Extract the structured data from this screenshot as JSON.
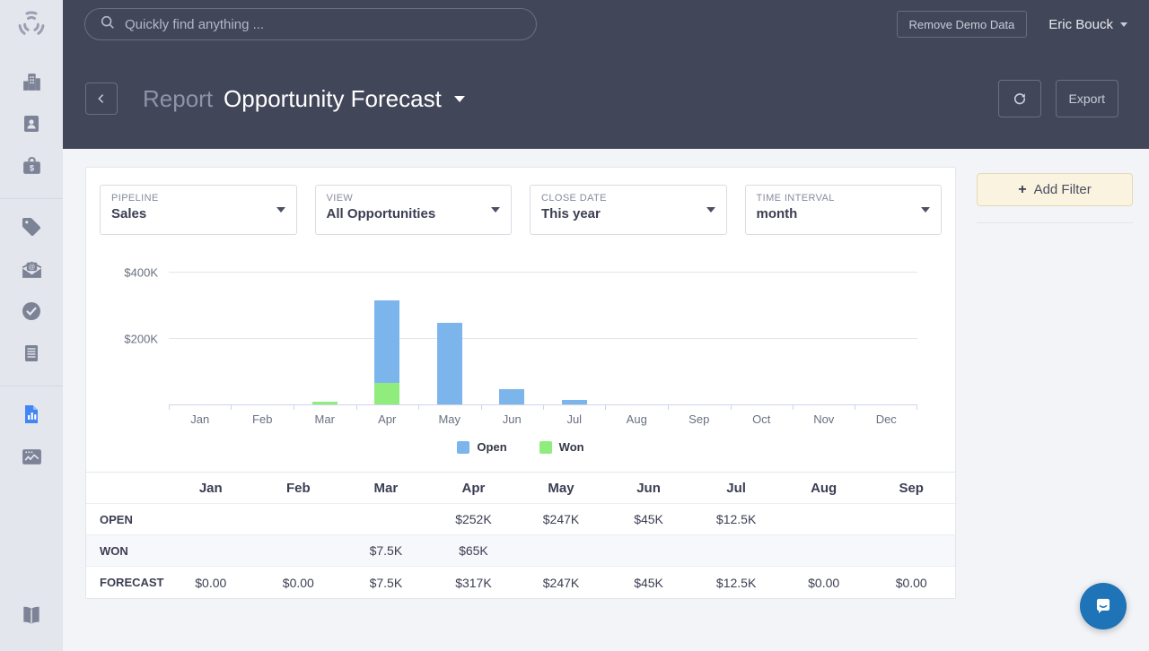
{
  "topbar": {
    "search_placeholder": "Quickly find anything ...",
    "remove_demo_label": "Remove Demo Data",
    "user_name": "Eric Bouck"
  },
  "report_header": {
    "kicker": "Report",
    "title": "Opportunity Forecast",
    "export_label": "Export"
  },
  "filters": [
    {
      "label": "PIPELINE",
      "value": "Sales"
    },
    {
      "label": "VIEW",
      "value": "All Opportunities"
    },
    {
      "label": "CLOSE DATE",
      "value": "This year"
    },
    {
      "label": "TIME INTERVAL",
      "value": "month"
    }
  ],
  "side_panel": {
    "add_filter_label": "Add Filter",
    "plus": "+"
  },
  "chart_data": {
    "type": "bar",
    "stacked": true,
    "categories": [
      "Jan",
      "Feb",
      "Mar",
      "Apr",
      "May",
      "Jun",
      "Jul",
      "Aug",
      "Sep",
      "Oct",
      "Nov",
      "Dec"
    ],
    "series": [
      {
        "name": "Won",
        "color": "#90ed7d",
        "values": [
          0,
          0,
          7500,
          65000,
          0,
          0,
          0,
          0,
          0,
          0,
          0,
          0
        ]
      },
      {
        "name": "Open",
        "color": "#7cb5ec",
        "values": [
          0,
          0,
          0,
          252000,
          247000,
          45000,
          12500,
          0,
          0,
          0,
          0,
          0
        ]
      }
    ],
    "legend": [
      {
        "name": "Open",
        "color": "#7cb5ec"
      },
      {
        "name": "Won",
        "color": "#90ed7d"
      }
    ],
    "yticks": [
      {
        "label": "$400K",
        "value": 400000
      },
      {
        "label": "$200K",
        "value": 200000
      }
    ],
    "ylim": [
      0,
      400000
    ],
    "grid": true,
    "legend_position": "bottom"
  },
  "table": {
    "columns": [
      "Jan",
      "Feb",
      "Mar",
      "Apr",
      "May",
      "Jun",
      "Jul",
      "Aug",
      "Sep"
    ],
    "rows": [
      {
        "label": "OPEN",
        "values": [
          "",
          "",
          "",
          "$252K",
          "$247K",
          "$45K",
          "$12.5K",
          "",
          ""
        ]
      },
      {
        "label": "WON",
        "values": [
          "",
          "",
          "$7.5K",
          "$65K",
          "",
          "",
          "",
          "",
          ""
        ]
      },
      {
        "label": "FORECAST",
        "values": [
          "$0.00",
          "$0.00",
          "$7.5K",
          "$317K",
          "$247K",
          "$45K",
          "$12.5K",
          "$0.00",
          "$0.00"
        ]
      }
    ]
  },
  "colors": {
    "open_bar": "#7cb5ec",
    "won_bar": "#90ed7d",
    "header_bg": "#424659",
    "rail_bg": "#e4e6ee",
    "active_icon": "#4285f4",
    "add_filter_bg": "#faf3df",
    "intercom": "#1f73b7"
  },
  "icons": {
    "logo": "radial-burst",
    "search": "magnifier",
    "sidebar": [
      "companies",
      "contacts",
      "opportunities",
      "tags",
      "email",
      "tasks",
      "notes",
      "reports",
      "insights",
      "help-book"
    ],
    "active_sidebar_item": "reports"
  }
}
